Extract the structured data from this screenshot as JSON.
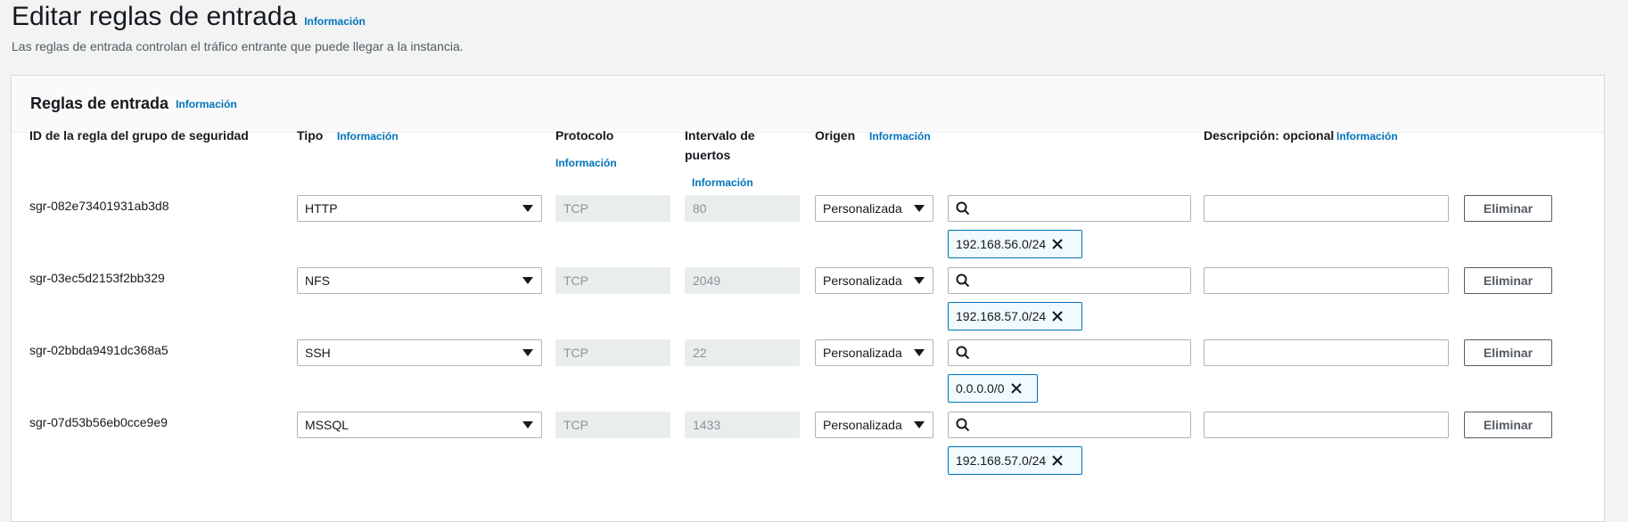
{
  "page": {
    "title": "Editar reglas de entrada",
    "info": "Información",
    "subtitle": "Las reglas de entrada controlan el tráfico entrante que puede llegar a la instancia."
  },
  "panel": {
    "title": "Reglas de entrada",
    "info": "Información"
  },
  "columns": {
    "rule_id": "ID de la regla del grupo de seguridad",
    "type": "Tipo",
    "type_info": "Información",
    "protocol": "Protocolo",
    "protocol_info": "Información",
    "port_range_line1": "Intervalo de",
    "port_range_line2": "puertos",
    "port_range_info": "Información",
    "source": "Origen",
    "source_info": "Información",
    "description": "Descripción: opcional",
    "description_info": "Información"
  },
  "rules": [
    {
      "id": "sgr-082e73401931ab3d8",
      "type": "HTTP",
      "protocol": "TCP",
      "port": "80",
      "source": "Personalizada",
      "cidr": "192.168.56.0/24",
      "delete_label": "Eliminar"
    },
    {
      "id": "sgr-03ec5d2153f2bb329",
      "type": "NFS",
      "protocol": "TCP",
      "port": "2049",
      "source": "Personalizada",
      "cidr": "192.168.57.0/24",
      "delete_label": "Eliminar"
    },
    {
      "id": "sgr-02bbda9491dc368a5",
      "type": "SSH",
      "protocol": "TCP",
      "port": "22",
      "source": "Personalizada",
      "cidr": "0.0.0.0/0",
      "delete_label": "Eliminar"
    },
    {
      "id": "sgr-07d53b56eb0cce9e9",
      "type": "MSSQL",
      "protocol": "TCP",
      "port": "1433",
      "source": "Personalizada",
      "cidr": "192.168.57.0/24",
      "delete_label": "Eliminar"
    }
  ],
  "colors": {
    "link": "#0073bb",
    "token_border": "#0073bb",
    "token_bg": "#f1faff",
    "readonly_bg": "#eaeded"
  },
  "icons": {
    "search": "search-icon",
    "remove": "close-icon",
    "dropdown": "caret-down-icon"
  }
}
